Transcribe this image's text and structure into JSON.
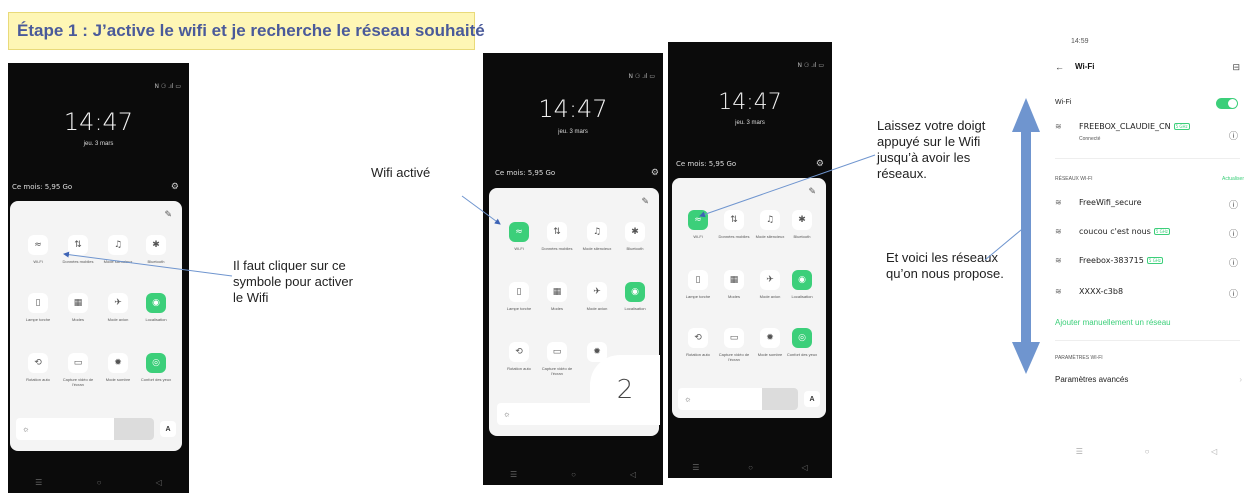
{
  "title": "Étape 1 : J’active le wifi et je recherche le réseau souhaité",
  "phone": {
    "time": "14:47",
    "date": "jeu. 3 mars",
    "data_usage": "Ce mois: 5,95 Go",
    "status_icons": "N ⚆ .ıl ▭"
  },
  "tiles": {
    "wifi": "Wi-Fi",
    "donnees": "Données mobiles",
    "mode_silencieux": "Mode silencieux",
    "bluetooth": "Bluetooth",
    "lampe": "Lampe torche",
    "modes": "Modes",
    "mode_avion": "Mode avion",
    "localisation": "Localisation",
    "rotation": "Rotation auto",
    "capture": "Capture vidéo de l'écran",
    "mode_sombre": "Mode sombre",
    "confort": "Confort des yeux"
  },
  "brightness_letter": "A",
  "notes": {
    "cliquer": "Il faut cliquer sur ce symbole pour activer le Wifi",
    "wifi_active": "Wifi activé",
    "laissez": "Laissez votre doigt appuyé sur le Wifi jusqu’à avoir les réseaux.",
    "voici": "Et voici les réseaux qu’on nous propose."
  },
  "step_number": "2",
  "wifi_settings": {
    "status_time": "14:59",
    "header": "Wi-Fi",
    "toggle_label": "Wi-Fi",
    "connected_name": "FREEBOX_CLAUDIE_CN",
    "connected_tag": "5 GHz",
    "connected_status": "Connecté",
    "section_networks": "RÉSEAUX WI-FI",
    "refresh": "Actualiser",
    "networks": [
      {
        "name": "FreeWifi_secure",
        "tag": ""
      },
      {
        "name": "coucou c'est nous",
        "tag": "5 GHz"
      },
      {
        "name": "Freebox-383715",
        "tag": "5 GHz"
      },
      {
        "name": "XXXX-c3b8",
        "tag": ""
      }
    ],
    "add_network": "Ajouter manuellement un réseau",
    "section_params": "PARAMÈTRES WI-FI",
    "advanced": "Paramètres avancés"
  },
  "colors": {
    "accent_green": "#3ccf7a",
    "arrow_blue": "#6f95cf",
    "title_bg": "#fef6b5"
  }
}
